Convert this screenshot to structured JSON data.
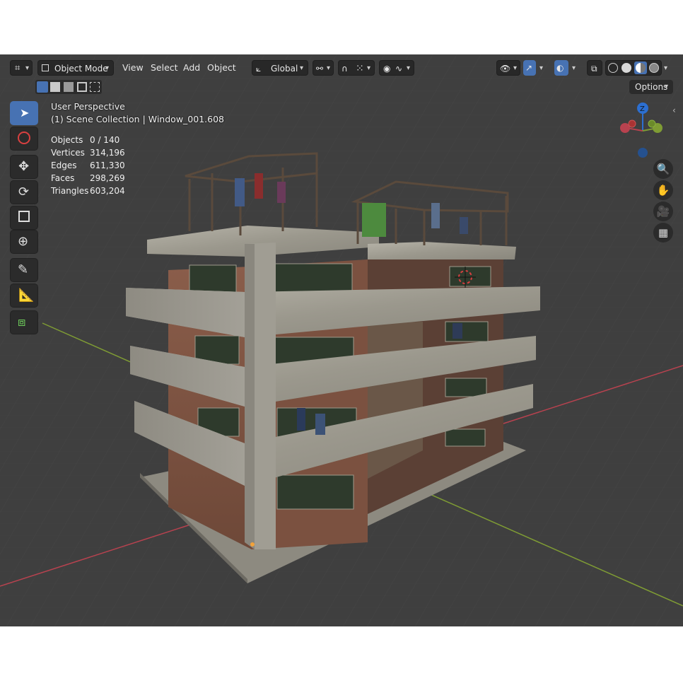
{
  "header": {
    "mode_label": "Object Mode",
    "menus": [
      "View",
      "Select",
      "Add",
      "Object"
    ],
    "transform_orientation": "Global"
  },
  "options_label": "Options",
  "overlay": {
    "perspective": "User Perspective",
    "collection": "(1) Scene Collection | Window_001.608"
  },
  "stats": [
    {
      "label": "Objects",
      "value": "0 / 140"
    },
    {
      "label": "Vertices",
      "value": "314,196"
    },
    {
      "label": "Edges",
      "value": "611,330"
    },
    {
      "label": "Faces",
      "value": "298,269"
    },
    {
      "label": "Triangles",
      "value": "603,204"
    }
  ],
  "gizmo": {
    "z_label": "Z"
  },
  "colors": {
    "accent": "#4772b3",
    "x_axis": "#b8424f",
    "y_axis": "#7f9c34",
    "z_axis": "#2c6fd1"
  }
}
